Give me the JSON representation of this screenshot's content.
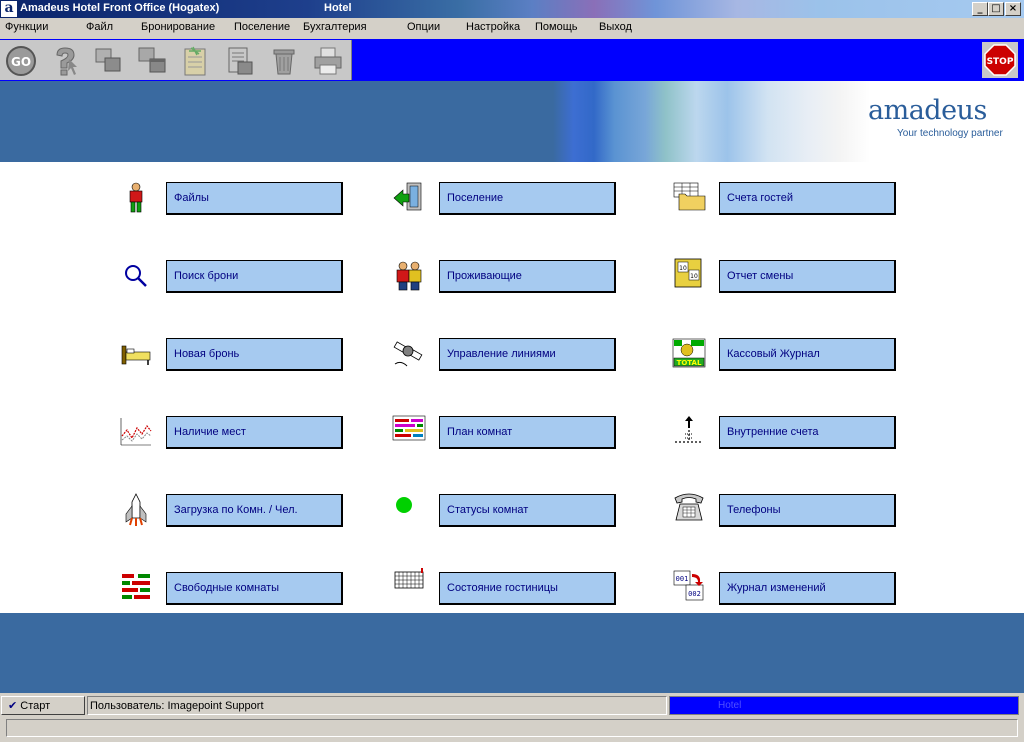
{
  "window": {
    "title": "Amadeus Hotel Front Office (Hogatex)",
    "subtitle": "Hotel",
    "app_icon_letter": "a",
    "controls": {
      "minimize": "_",
      "maximize": "□",
      "close": "×"
    }
  },
  "menu": [
    "Функции",
    "Файл",
    "Бронирование",
    "Поселение",
    "Бухгалтерия",
    "Опции",
    "Настройка",
    "Помощь",
    "Выход"
  ],
  "toolbar": {
    "go_label": "GO",
    "stop_label": "STOP",
    "buttons": [
      "go-icon",
      "help-icon",
      "copy-windows-icon",
      "windows-icon",
      "notepad-icon",
      "report-icon",
      "trash-icon",
      "printer-icon"
    ]
  },
  "banner": {
    "logo": "amadeus",
    "tagline": "Your technology partner"
  },
  "main": {
    "columns": [
      [
        {
          "label": "Файлы",
          "icon": "person-icon"
        },
        {
          "label": "Поиск брони",
          "icon": "magnifier-icon"
        },
        {
          "label": "Новая бронь",
          "icon": "bed-icon"
        },
        {
          "label": "Наличие мест",
          "icon": "line-chart-icon"
        },
        {
          "label": "Загрузка по Комн. / Чел.",
          "icon": "rocket-icon"
        },
        {
          "label": "Свободные комнаты",
          "icon": "grid-blocks-icon"
        }
      ],
      [
        {
          "label": "Поселение",
          "icon": "door-arrow-icon"
        },
        {
          "label": "Проживающие",
          "icon": "people-icon"
        },
        {
          "label": "Управление линиями",
          "icon": "satellite-icon"
        },
        {
          "label": "План комнат",
          "icon": "room-plan-icon"
        },
        {
          "label": "Статусы комнат",
          "icon": "green-dot-icon"
        },
        {
          "label": "Состояние гостиницы",
          "icon": "calendar-grid-icon"
        }
      ],
      [
        {
          "label": "Счета гостей",
          "icon": "folder-table-icon"
        },
        {
          "label": "Отчет смены",
          "icon": "calendar-book-icon"
        },
        {
          "label": "Кассовый Журнал",
          "icon": "total-ledger-icon"
        },
        {
          "label": "Внутренние счета",
          "icon": "house-arrow-icon"
        },
        {
          "label": "Телефоны",
          "icon": "telephone-icon"
        },
        {
          "label": "Журнал изменений",
          "icon": "change-log-icon"
        }
      ]
    ]
  },
  "status": {
    "start_label": "Старт",
    "user_text": "Пользователь: Imagepoint Support",
    "blue_text": "Hotel"
  }
}
